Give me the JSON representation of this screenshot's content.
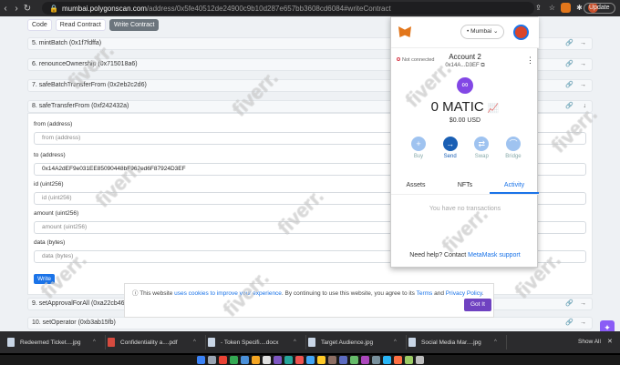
{
  "browser": {
    "url_host": "mumbai.polygonscan.com",
    "url_path": "/address/0x5fe40512de24900c9b10d287e657bb3608cd6084#writeContract",
    "update_label": "Update"
  },
  "page": {
    "tabs": [
      "Code",
      "Read Contract",
      "Write Contract"
    ],
    "rows_top": [
      "5. mintBatch (0x1f7fdffa)",
      "6. renounceOwnership (0x715018a6)",
      "7. safeBatchTransferFrom (0x2eb2c2d6)",
      "8. safeTransferFrom (0xf242432a)"
    ],
    "rows_bottom": [
      "9. setApprovalForAll (0xa22cb465)",
      "10. setOperator (0xb3ab15fb)"
    ],
    "form": {
      "from_label": "from (address)",
      "from_placeholder": "from (address)",
      "to_label": "to (address)",
      "to_value": "0x14A2dEF9e031EE85090448bF962ed6F87924D3EF",
      "id_label": "id (uint256)",
      "id_placeholder": "id (uint256)",
      "amount_label": "amount (uint256)",
      "amount_placeholder": "amount (uint256)",
      "data_label": "data (bytes)",
      "data_placeholder": "data (bytes)",
      "write_label": "Write"
    },
    "cookie": {
      "text1": "This website ",
      "link1": "uses cookies to improve your experience",
      "text2": ". By continuing to use this website, you agree to its ",
      "link2": "Terms",
      "text3": " and ",
      "link3": "Privacy Policy",
      "text4": ".",
      "button": "Got It"
    }
  },
  "metamask": {
    "network": "Mumbai",
    "status": "Not connected",
    "account_name": "Account 2",
    "account_address": "0x14A...D3EF",
    "balance": "0 MATIC",
    "balance_usd": "$0.00 USD",
    "actions": [
      "Buy",
      "Send",
      "Swap",
      "Bridge"
    ],
    "tabs": [
      "Assets",
      "NFTs",
      "Activity"
    ],
    "empty_text": "You have no transactions",
    "help_text": "Need help? Contact ",
    "help_link": "MetaMask support",
    "colors": {
      "accent": "#1a73e8",
      "fox": "#e2761b",
      "matic": "#8247e5"
    }
  },
  "downloads": {
    "items": [
      "Redeemed Ticket....jpg",
      "Confidentiality a....pdf",
      "- Token Specifi....docx",
      "Target Audience.jpg",
      "Social Media Mar....jpg"
    ],
    "show_all": "Show All"
  },
  "watermark": "fiverr."
}
